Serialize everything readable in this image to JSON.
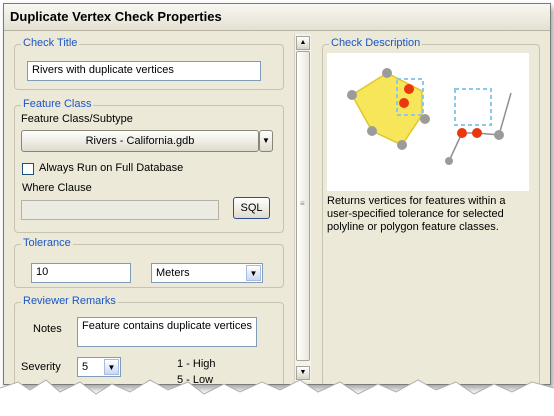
{
  "window": {
    "title": "Duplicate Vertex Check Properties"
  },
  "check_title": {
    "legend": "Check Title",
    "value": "Rivers with duplicate vertices"
  },
  "feature_class": {
    "legend": "Feature Class",
    "subtype_label": "Feature Class/Subtype",
    "selected": "Rivers -  California.gdb",
    "always_run_label": "Always Run on Full Database",
    "always_run_checked": false,
    "where_clause_label": "Where Clause",
    "where_clause_value": "",
    "sql_button": "SQL"
  },
  "tolerance": {
    "legend": "Tolerance",
    "value": "10",
    "units": "Meters"
  },
  "reviewer_remarks": {
    "legend": "Reviewer Remarks",
    "notes_label": "Notes",
    "notes_value": "Feature contains duplicate vertices",
    "severity_label": "Severity",
    "severity_value": "5",
    "legend_high": "1 - High",
    "legend_low": "5 - Low"
  },
  "description": {
    "legend": "Check Description",
    "text": "Returns vertices for features within a user-specified tolerance for selected polyline or polygon feature classes."
  },
  "colors": {
    "legend_blue": "#1a55c7",
    "vertex_red": "#e8380d",
    "polygon_yellow": "#f7e65a",
    "tolerance_box": "#8cc8ea"
  }
}
